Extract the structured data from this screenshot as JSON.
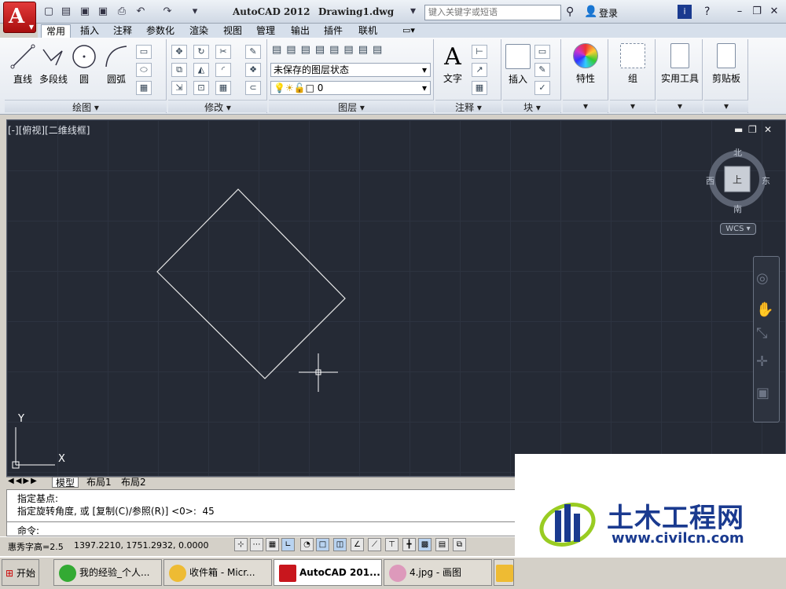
{
  "app": {
    "title": "AutoCAD 2012",
    "document": "Drawing1.dwg"
  },
  "search": {
    "placeholder": "键入关键字或短语"
  },
  "header": {
    "login": "登录"
  },
  "tabs": [
    {
      "label": "常用",
      "active": true
    },
    {
      "label": "插入"
    },
    {
      "label": "注释"
    },
    {
      "label": "参数化"
    },
    {
      "label": "渲染"
    },
    {
      "label": "视图"
    },
    {
      "label": "管理"
    },
    {
      "label": "输出"
    },
    {
      "label": "插件"
    },
    {
      "label": "联机"
    }
  ],
  "ribbon": {
    "draw": {
      "title": "绘图",
      "line": "直线",
      "polyline": "多段线",
      "circle": "圆",
      "arc": "圆弧"
    },
    "modify": {
      "title": "修改"
    },
    "layers": {
      "title": "图层",
      "state": "未保存的图层状态",
      "current": "0"
    },
    "annotation": {
      "title": "注释",
      "text": "文字"
    },
    "block": {
      "title": "块",
      "insert": "插入"
    },
    "properties": {
      "label": "特性"
    },
    "groups": {
      "label": "组"
    },
    "utilities": {
      "label": "实用工具"
    },
    "clipboard": {
      "label": "剪贴板"
    }
  },
  "viewport": {
    "label": "[-][俯视][二维线框]",
    "viewcube": {
      "north": "北",
      "south": "南",
      "east": "东",
      "west": "西",
      "top": "上"
    },
    "wcs": "WCS",
    "ucs": {
      "x": "X",
      "y": "Y"
    }
  },
  "layout_tabs": [
    "模型",
    "布局1",
    "布局2"
  ],
  "command": {
    "line1": "指定基点:",
    "line2": "指定旋转角度, 或 [复制(C)/参照(R)] <0>:  45",
    "prompt": "命令:"
  },
  "status": {
    "text_height": "惠秀字高=2.5",
    "coords": "1397.2210, 1751.2932, 0.0000"
  },
  "taskbar": {
    "start": "开始",
    "items": [
      {
        "label": "我的经验_个人..."
      },
      {
        "label": "收件箱 - Micr..."
      },
      {
        "label": "AutoCAD 201...",
        "active": true
      },
      {
        "label": "4.jpg - 画图"
      }
    ]
  },
  "watermark": {
    "name": "土木工程网",
    "url": "www.civilcn.com"
  },
  "colors": {
    "viewport_bg": "#252a35",
    "app_red": "#c8161d",
    "brand_blue": "#1a3a8f"
  }
}
